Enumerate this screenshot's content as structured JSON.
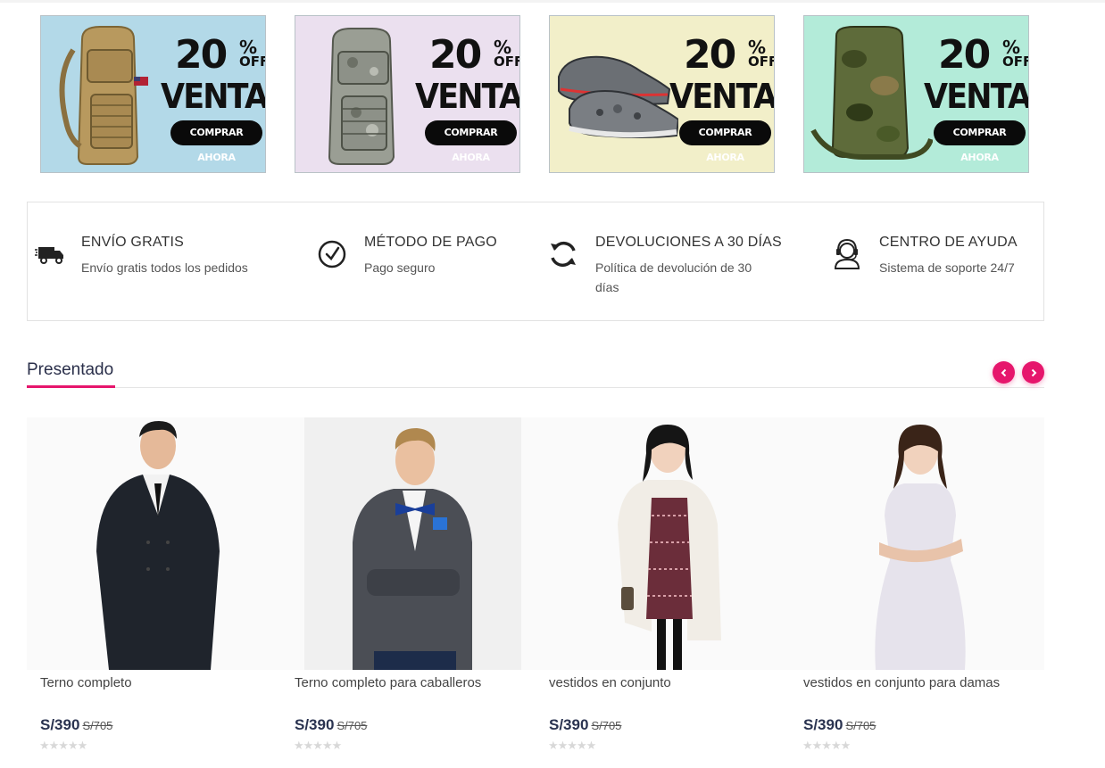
{
  "banners": [
    {
      "bg": "#b3d9e8",
      "product": "tan-backpack-image",
      "percent": "20",
      "percent_sign": "%",
      "off": "OFF",
      "title": "VENTA",
      "cta": "COMPRAR AHORA"
    },
    {
      "bg": "#ebe0ef",
      "product": "digital-camo-backpack-image",
      "percent": "20",
      "percent_sign": "%",
      "off": "OFF",
      "title": "VENTA",
      "cta": "COMPRAR AHORA"
    },
    {
      "bg": "#f2efc9",
      "product": "grey-sneakers-image",
      "percent": "20",
      "percent_sign": "%",
      "off": "OFF",
      "title": "VENTA",
      "cta": "COMPRAR AHORA"
    },
    {
      "bg": "#b3ebd9",
      "product": "green-camo-backpack-image",
      "percent": "20",
      "percent_sign": "%",
      "off": "OFF",
      "title": "VENTA",
      "cta": "COMPRAR AHORA"
    }
  ],
  "features": [
    {
      "icon": "truck-icon",
      "title": "ENVÍO GRATIS",
      "subtitle": "Envío gratis todos los pedidos"
    },
    {
      "icon": "check-circle-icon",
      "title": "MÉTODO DE PAGO",
      "subtitle": "Pago seguro"
    },
    {
      "icon": "refresh-icon",
      "title": "DEVOLUCIONES A 30 DÍAS",
      "subtitle": "Política de devolución de 30 días"
    },
    {
      "icon": "support-agent-icon",
      "title": "CENTRO DE AYUDA",
      "subtitle": "Sistema de soporte 24/7"
    }
  ],
  "section": {
    "title": "Presentado",
    "prev_icon": "chevron-left-icon",
    "next_icon": "chevron-right-icon"
  },
  "colors": {
    "accent": "#e6166c",
    "price": "#2a3350"
  },
  "products": [
    {
      "name": "Terno completo",
      "price": "S/390",
      "old_price": "S/705",
      "stars": "★★★★★",
      "rating": 0
    },
    {
      "name": "Terno completo para caballeros",
      "price": "S/390",
      "old_price": "S/705",
      "stars": "★★★★★",
      "rating": 0
    },
    {
      "name": "vestidos en conjunto",
      "price": "S/390",
      "old_price": "S/705",
      "stars": "★★★★★",
      "rating": 0
    },
    {
      "name": "vestidos en conjunto para damas",
      "price": "S/390",
      "old_price": "S/705",
      "stars": "★★★★★",
      "rating": 0
    }
  ]
}
